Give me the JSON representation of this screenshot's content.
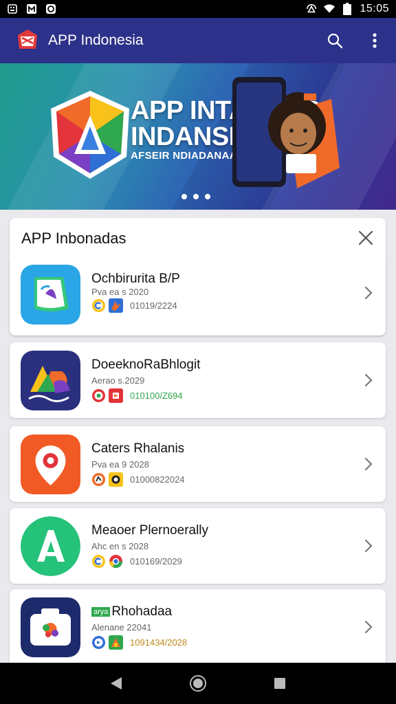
{
  "status_bar": {
    "time": "15:05",
    "icons": [
      "sim-icon",
      "notification-icon",
      "notification-icon",
      "hotspot-icon",
      "wifi-icon",
      "battery-icon"
    ]
  },
  "app_bar": {
    "title": "APP Indonesia",
    "logo": "app-logo-icon",
    "actions": [
      "search-icon",
      "more-vert-icon"
    ],
    "color": "#2c318a"
  },
  "banner": {
    "title_line1": "APP INTANDAP",
    "title_line2": "INDANSIA",
    "subtitle": "AFSEIR NDIADANAA",
    "page_count": 3
  },
  "panel": {
    "title": "APP Inbonadas",
    "close_icon": "close-icon"
  },
  "apps": [
    {
      "name": "Ochbirurita B/P",
      "date": "Pva ea s 2020",
      "code": "01019/2224",
      "code_color": "#666666",
      "icon_color": "#2aa5e6"
    },
    {
      "name": "DoeeknoRaBhlogit",
      "date": "Aerao s.2029",
      "code": "010100/Z694",
      "code_color": "#2fa84f",
      "icon_color": "#2a2f7e"
    },
    {
      "name": "Caters Rhalanis",
      "date": "Pva ea 9 2028",
      "code": "01000822024",
      "code_color": "#666666",
      "icon_color": "#f25a25"
    },
    {
      "name": "Meaoer Plernoerally",
      "date": "Ahc en s 2028",
      "code": "010169/2029",
      "code_color": "#666666",
      "icon_color": "#25c27a"
    },
    {
      "name": "Rhohadaa",
      "name_prefix": "arya",
      "date": "Alenane 22041",
      "code": "1091434/2028",
      "code_color": "#c08a1a",
      "icon_color": "#1d2a6b"
    }
  ]
}
